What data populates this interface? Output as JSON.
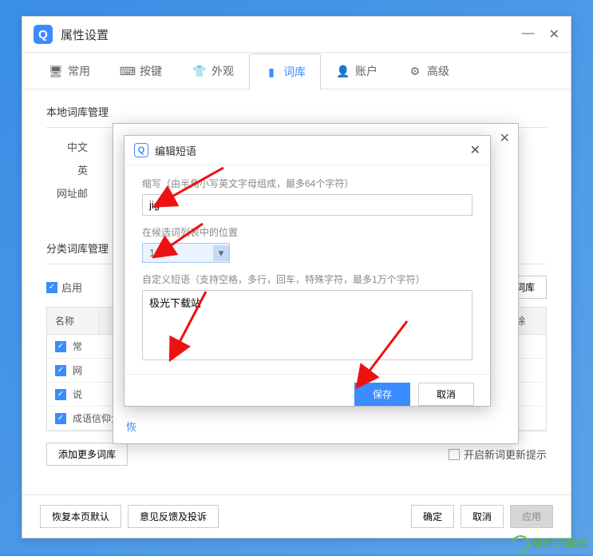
{
  "window": {
    "title": "属性设置"
  },
  "tabs": {
    "t0": "常用",
    "t1": "按键",
    "t2": "外观",
    "t3": "词库",
    "t4": "账户",
    "t5": "高级"
  },
  "sections": {
    "local": "本地词库管理",
    "category": "分类词库管理"
  },
  "rows": {
    "r0": "中文",
    "r1": "英",
    "r2": "网址邮",
    "enable": "启用",
    "bind_lib": "定词库"
  },
  "table": {
    "h_name": "名称",
    "h_delete": "删除",
    "rows": {
      "r0": "常",
      "r1": "网",
      "r2": "说",
      "r3": "成语信仰大王"
    }
  },
  "buttons": {
    "add_more": "添加更多词库",
    "enable_notify": "开启新词更新提示",
    "restore": "恢复本页默认",
    "feedback": "意见反馈及投诉",
    "ok": "确定",
    "cancel": "取消",
    "apply": "应用"
  },
  "dialog2": {
    "restore": "恢"
  },
  "dialog3": {
    "title": "编辑短语",
    "abbr_label": "缩写（由半角小写英文字母组成，最多64个字符）",
    "abbr_value": "jig",
    "pos_label": "在候选词列表中的位置",
    "pos_value": "1",
    "phrase_label": "自定义短语（支持空格，多行，回车，特殊字符，最多1万个字符）",
    "phrase_value": "极光下载站",
    "save": "保存",
    "cancel": "取消"
  },
  "watermark": "极光下载站"
}
